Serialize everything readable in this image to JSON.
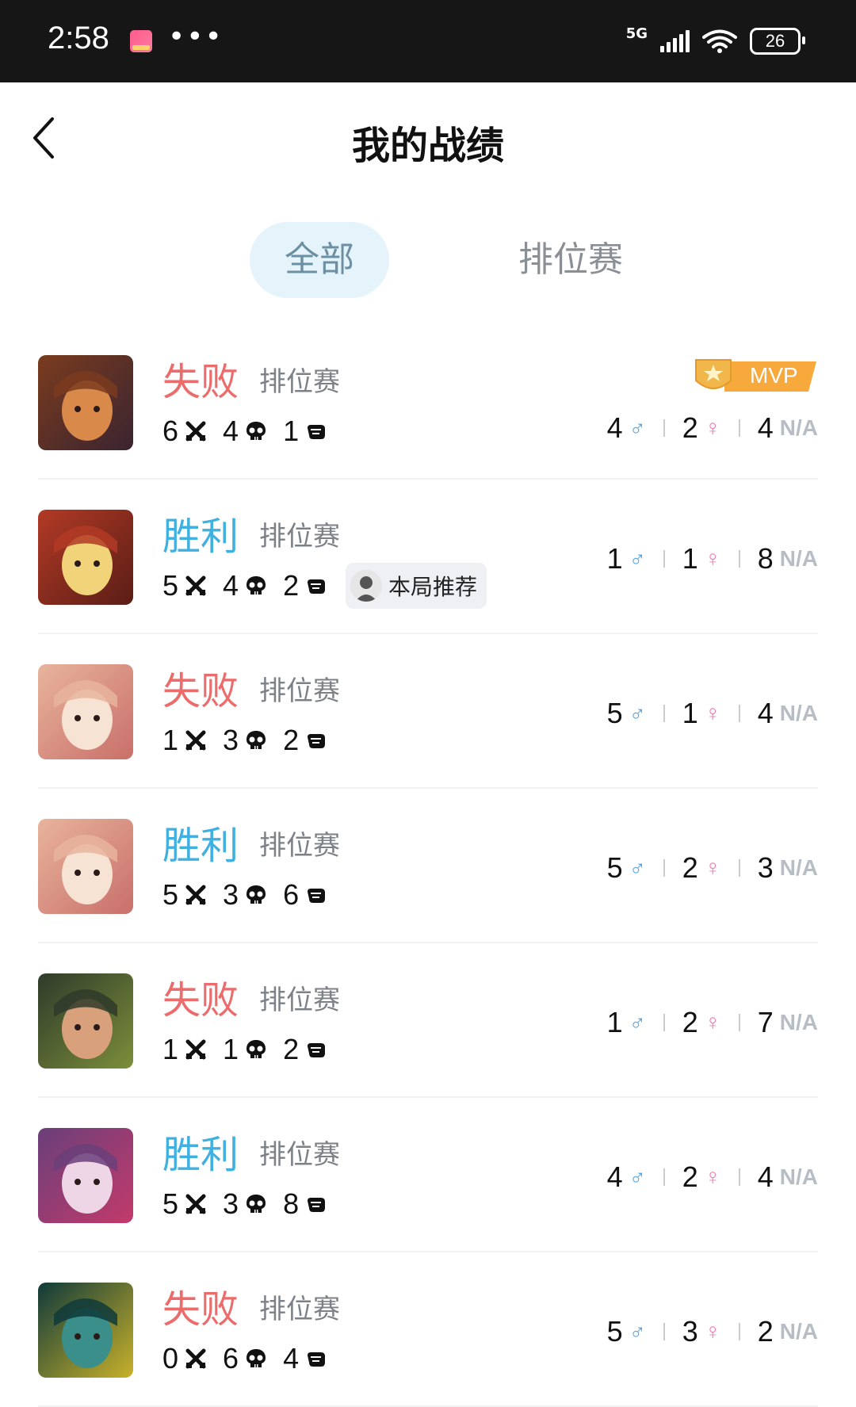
{
  "status_bar": {
    "time": "2:58",
    "network": "5G",
    "battery": "26"
  },
  "header": {
    "title": "我的战绩"
  },
  "tabs": [
    {
      "label": "全部",
      "active": true
    },
    {
      "label": "排位赛",
      "active": false
    }
  ],
  "colors": {
    "lose": "#ec6b6b",
    "win": "#3fb0e0",
    "male": "#4ea4e6",
    "female": "#f07bb0",
    "mvp": "#f7a93b"
  },
  "mvp_label": "MVP",
  "recommend_label": "本局推荐",
  "na_label": "N/A",
  "stat_icons": [
    "sword-cross-icon",
    "skull-icon",
    "fist-icon"
  ],
  "matches": [
    {
      "result": "失败",
      "mode": "排位赛",
      "kills": "6",
      "deaths": "4",
      "assists": "1",
      "male": "4",
      "female": "2",
      "na": "4"
    },
    {
      "result": "胜利",
      "mode": "排位赛",
      "kills": "5",
      "deaths": "4",
      "assists": "2",
      "male": "1",
      "female": "1",
      "na": "8"
    },
    {
      "result": "失败",
      "mode": "排位赛",
      "kills": "1",
      "deaths": "3",
      "assists": "2",
      "male": "5",
      "female": "1",
      "na": "4"
    },
    {
      "result": "胜利",
      "mode": "排位赛",
      "kills": "5",
      "deaths": "3",
      "assists": "6",
      "male": "5",
      "female": "2",
      "na": "3"
    },
    {
      "result": "失败",
      "mode": "排位赛",
      "kills": "1",
      "deaths": "1",
      "assists": "2",
      "male": "1",
      "female": "2",
      "na": "7"
    },
    {
      "result": "胜利",
      "mode": "排位赛",
      "kills": "5",
      "deaths": "3",
      "assists": "8",
      "male": "4",
      "female": "2",
      "na": "4"
    },
    {
      "result": "失败",
      "mode": "排位赛",
      "kills": "0",
      "deaths": "6",
      "assists": "4",
      "male": "5",
      "female": "3",
      "na": "2"
    }
  ]
}
